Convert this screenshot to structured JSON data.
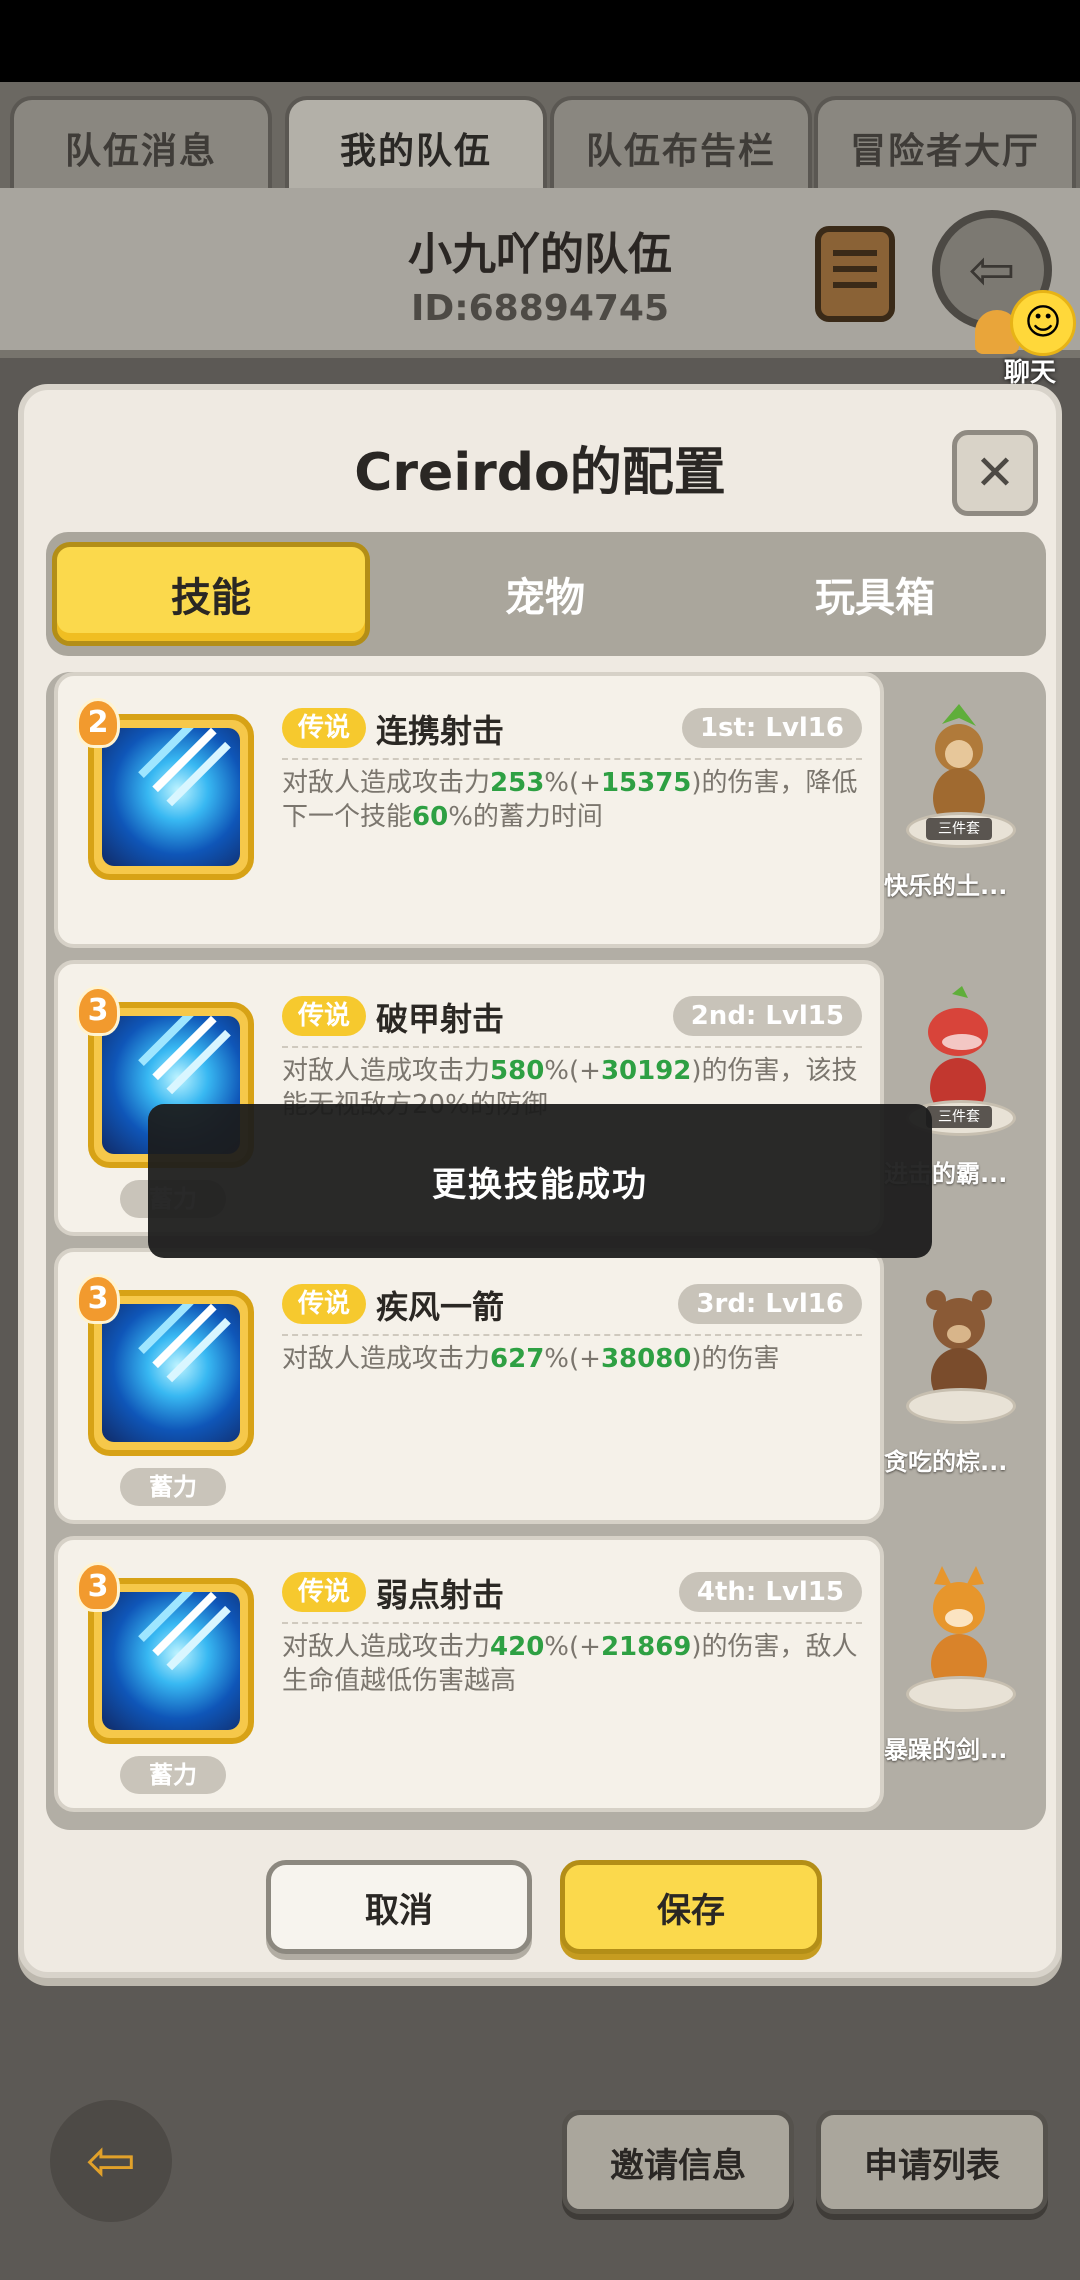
{
  "top_tabs": [
    {
      "label": "队伍消息",
      "active": false
    },
    {
      "label": "我的队伍",
      "active": true
    },
    {
      "label": "队伍布告栏",
      "active": false
    },
    {
      "label": "冒险者大厅",
      "active": false
    }
  ],
  "team": {
    "name": "小九吖的队伍",
    "id": "ID:68894745",
    "scroll_icon": "scroll-icon",
    "exit_icon": "exit-arrow-icon"
  },
  "chat": {
    "label": "聊天",
    "icon": "chat-bubble-icon"
  },
  "modal": {
    "title": "Creirdo的配置",
    "close_glyph": "✕",
    "tabs": [
      {
        "label": "技能",
        "active": true
      },
      {
        "label": "宠物",
        "active": false
      },
      {
        "label": "玩具箱",
        "active": false
      }
    ],
    "skills": [
      {
        "level": "2",
        "rarity": "传说",
        "name": "连携射击",
        "slot": "1st: Lvl16",
        "desc_parts": [
          "对敌人造成攻击力",
          "253",
          "%(+",
          "15375",
          ")的伤害，降低下一个技能",
          "60",
          "%的蓄力时间"
        ],
        "charge": "",
        "icon": "arrow-volley-icon"
      },
      {
        "level": "3",
        "rarity": "传说",
        "name": "破甲射击",
        "slot": "2nd: Lvl15",
        "desc_parts": [
          "对敌人造成攻击力",
          "580",
          "%(+",
          "30192",
          ")的伤害，该技能无视敌方20%的防御",
          "",
          ""
        ],
        "charge": "蓄力",
        "icon": "armor-pierce-icon"
      },
      {
        "level": "3",
        "rarity": "传说",
        "name": "疾风一箭",
        "slot": "3rd: Lvl16",
        "desc_parts": [
          "对敌人造成攻击力",
          "627",
          "%(+",
          "38080",
          ")的伤害",
          "",
          ""
        ],
        "charge": "蓄力",
        "icon": "gale-arrow-icon"
      },
      {
        "level": "3",
        "rarity": "传说",
        "name": "弱点射击",
        "slot": "4th: Lvl15",
        "desc_parts": [
          "对敌人造成攻击力",
          "420",
          "%(+",
          "21869",
          ")的伤害，敌人生命值越低伤害越高",
          "",
          ""
        ],
        "charge": "蓄力",
        "icon": "weak-point-shot-icon"
      }
    ],
    "pets": [
      {
        "name": "快乐的土...",
        "tag": "三件套",
        "icon": "monkey-pet-icon",
        "color": "#b07a3a"
      },
      {
        "name": "进击的霸...",
        "tag": "三件套",
        "icon": "red-dino-pet-icon",
        "color": "#d8443a"
      },
      {
        "name": "贪吃的棕...",
        "tag": "",
        "icon": "brown-bear-pet-icon",
        "color": "#8a5a36"
      },
      {
        "name": "暴躁的剑...",
        "tag": "",
        "icon": "orange-cat-pet-icon",
        "color": "#e7962c"
      }
    ],
    "cancel_label": "取消",
    "save_label": "保存"
  },
  "toast": {
    "text": "更换技能成功"
  },
  "bottom": {
    "back_icon": "back-arrow-icon",
    "invite_label": "邀请信息",
    "apply_label": "申请列表"
  }
}
